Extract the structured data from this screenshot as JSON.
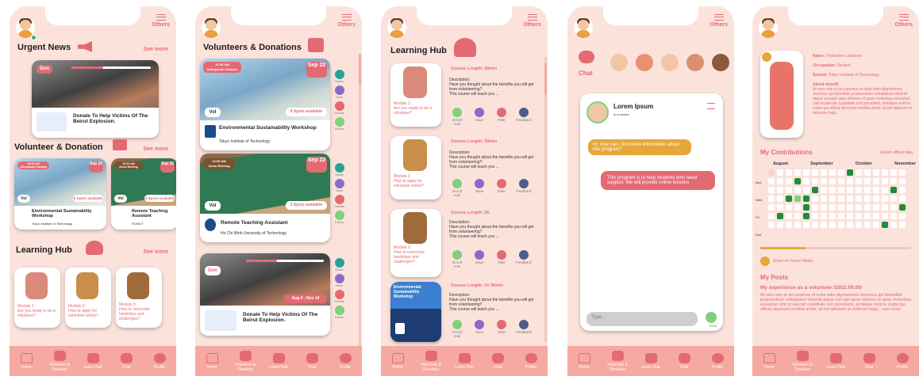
{
  "nav": [
    "Home",
    "Volunteer & Donation",
    "Learn Hub",
    "Chat",
    "Profile"
  ],
  "others": "Others",
  "s1": {
    "urgent": "Urgent News",
    "see": "See more",
    "news_title": "Donate To Help Victims Of The Beirut Explosion.",
    "don": "Don",
    "vd": "Volunteer & Donation",
    "vol1": {
      "date": "10:00 AM\nDabopanda Campus",
      "badge": "Sep 22",
      "vol": "Vol",
      "spots": "9 Spots available",
      "title": "Environmental Sustainability Workshop",
      "org": "Tokyo Institute of Technology"
    },
    "vol2": {
      "date": "10:00 AM\nZoom Meeting",
      "badge": "Sep 22",
      "vol": "Vol",
      "spots": "3 Spots available",
      "title": "Remote Teaching Assistant",
      "org": "HCMUT"
    },
    "lh": "Learning Hub",
    "m1": "Module 1:\nAre you ready to be a volunteer?",
    "m2": "Module 2:\nHow to apply for volunteer works?",
    "m3": "Module 3:\nHow to overcome hardships and challenges?"
  },
  "s2": {
    "title": "Volunteers & Donations",
    "c1": {
      "time": "10:30 AM\nDabopanda Campus",
      "badge": "Sep 22",
      "vol": "Vol",
      "spots": "9 Spots available",
      "title": "Environmental Sustainability Workshop",
      "org": "Tokyo Institute of Technology"
    },
    "c2": {
      "time": "10:00 AM\nZoom Meeting",
      "badge": "Sep 22",
      "vol": "Vol",
      "spots": "3 Spots available",
      "title": "Remote Teaching Assistant",
      "org": "Ho Chi Minh University of Technology"
    },
    "c3": {
      "badge": "Aug 4 - Nov 10",
      "don": "Don",
      "title": "Donate To Help Victims Of The Beirut Explosion."
    },
    "side": [
      "Share",
      "Save",
      "Donate",
      "Follow"
    ]
  },
  "s3": {
    "title": "Learning Hub",
    "modules": [
      {
        "len": "Course Length: 30min",
        "label": "Module 1:\nAre you ready to be a volunteer?"
      },
      {
        "len": "Course Length: 30min",
        "label": "Module 2:\nHow to apply for volunteer works?"
      },
      {
        "len": "Course Length: 2h",
        "label": "Module 3:\nHow to overcome hardships and challenges?"
      },
      {
        "len": "Course Length: 1h 30min",
        "label": "Environmental Sustainability Workshop"
      }
    ],
    "desc": "Description:\nHave you thought about the benefits you will get from volunteering?\nThis course will teach you ...",
    "more": "see more",
    "acts": [
      "Enroll now",
      "Save",
      "Rate",
      "Feedback"
    ]
  },
  "s4": {
    "chat": "Chat",
    "name": "Lorem Ipsum",
    "status": "is a mentor",
    "q": "Hi, how can i find more information about this program?",
    "a": "This program is to help students who need support. We will provide online lessons",
    "type": "Type...",
    "send": "Send"
  },
  "s5": {
    "name_l": "Name:",
    "name": "Firstname Lastname",
    "occ_l": "Occupation:",
    "occ": "Student",
    "school_l": "School:",
    "school": "Tokyo Institute of Technology",
    "about_l": "About myself:",
    "about": "At vero eos et accusamus et iusto odio dignissimos ducimus qui blanditiis praesentium voluptatum deleniti atque corrupti quos dolores et quas molestias excepturi sint occaecati cupiditate non provident, similique sunt in culpa qui officia deserunt mollitia animi, id est laborum et dolorum fuga.",
    "contrib": "My Contributions",
    "export": "Export official data",
    "months": [
      "August",
      "September",
      "October",
      "November"
    ],
    "days": [
      "Mon",
      "Wed",
      "Fri",
      "Sun"
    ],
    "share": "Share on Social Media",
    "posts": "My Posts",
    "post_title": "My experience as a volunteer /2022.09.05/",
    "post": "At vero eos et accusamus et iusto odio dignissimos ducimus qui blanditiis praesentium voluptatum deleniti atque corrupti quos dolores et quas molestias excepturi sint occaecati cupiditate non provident, similique sunt in culpa qui officia deserunt mollitia animi, id est laborum et dolorum fuga... see more"
  }
}
